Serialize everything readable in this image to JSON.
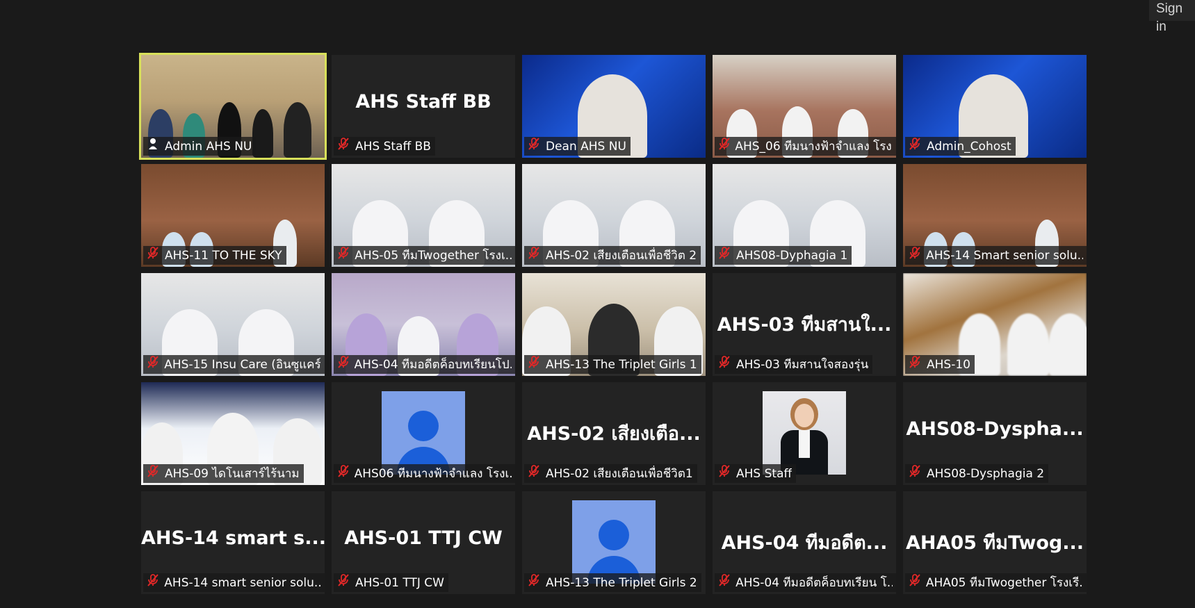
{
  "header": {
    "signin_label": "Sign in"
  },
  "colors": {
    "background": "#1a1a1a",
    "tile": "#232323",
    "active_speaker": "#d8e05a",
    "muted": "#e02828"
  },
  "participants": [
    {
      "name": "Admin AHS NU",
      "big": "",
      "kind": "video",
      "scene": "v-room",
      "active": true,
      "icon": "pin-icon"
    },
    {
      "name": "AHS Staff BB",
      "big": "AHS Staff BB",
      "kind": "name",
      "scene": "",
      "active": false,
      "icon": "mic-muted-icon"
    },
    {
      "name": "Dean AHS NU",
      "big": "",
      "kind": "video",
      "scene": "v-blue",
      "active": false,
      "icon": "mic-muted-icon"
    },
    {
      "name": "AHS_06 ทีมนางฟ้าจำแลง โรง...",
      "big": "",
      "kind": "video",
      "scene": "v-class",
      "active": false,
      "icon": "mic-muted-icon"
    },
    {
      "name": "Admin_Cohost",
      "big": "",
      "kind": "video",
      "scene": "v-blue",
      "active": false,
      "icon": "mic-muted-icon"
    },
    {
      "name": "AHS-11 TO THE SKY",
      "big": "",
      "kind": "video",
      "scene": "v-tv",
      "active": false,
      "icon": "mic-muted-icon"
    },
    {
      "name": "AHS-05 ทีมTwogether โรงเ...",
      "big": "",
      "kind": "video",
      "scene": "v-wall",
      "active": false,
      "icon": "mic-muted-icon"
    },
    {
      "name": "AHS-02 เสียงเตือนเพื่อชีวิต 2",
      "big": "",
      "kind": "video",
      "scene": "v-wall",
      "active": false,
      "icon": "mic-muted-icon"
    },
    {
      "name": "AHS08-Dyphagia 1",
      "big": "",
      "kind": "video",
      "scene": "v-wall",
      "active": false,
      "icon": "mic-muted-icon"
    },
    {
      "name": "AHS-14 Smart senior solu...",
      "big": "",
      "kind": "video",
      "scene": "v-tv",
      "active": false,
      "icon": "mic-muted-icon"
    },
    {
      "name": "AHS-15 Insu Care (อินซูแคร์)",
      "big": "",
      "kind": "video",
      "scene": "v-wall",
      "active": false,
      "icon": "mic-muted-icon"
    },
    {
      "name": "AHS-04 ทีมอดีตค็อบทเรียนโป...",
      "big": "",
      "kind": "video",
      "scene": "v-lib",
      "active": false,
      "icon": "mic-muted-icon"
    },
    {
      "name": "AHS-13 The Triplet Girls 1",
      "big": "",
      "kind": "video",
      "scene": "v-shelf",
      "active": false,
      "icon": "mic-muted-icon"
    },
    {
      "name": "AHS-03 ทีมสานใจสองรุ่น",
      "big": "AHS-03 ทีมสานใ...",
      "kind": "name",
      "scene": "",
      "active": false,
      "icon": "mic-muted-icon"
    },
    {
      "name": "AHS-10",
      "big": "",
      "kind": "video",
      "scene": "v-blur",
      "active": false,
      "icon": "mic-muted-icon"
    },
    {
      "name": "AHS-09 ไดโนเสาร์ไร้นาม",
      "big": "",
      "kind": "video",
      "scene": "v-dark",
      "active": false,
      "icon": "mic-muted-icon"
    },
    {
      "name": "AHS06 ทีมนางฟ้าจำแลง โรงเ...",
      "big": "",
      "kind": "avatar",
      "scene": "",
      "active": false,
      "icon": "mic-muted-icon"
    },
    {
      "name": "AHS-02 เสียงเตือนเพื่อชีวิต1",
      "big": "AHS-02 เสียงเตือ...",
      "kind": "name",
      "scene": "",
      "active": false,
      "icon": "mic-muted-icon"
    },
    {
      "name": "AHS Staff",
      "big": "",
      "kind": "photo",
      "scene": "",
      "active": false,
      "icon": "mic-muted-icon"
    },
    {
      "name": "AHS08-Dysphagia 2",
      "big": "AHS08-Dyspha...",
      "kind": "name",
      "scene": "",
      "active": false,
      "icon": "mic-muted-icon"
    },
    {
      "name": "AHS-14 smart senior solu...",
      "big": "AHS-14 smart s...",
      "kind": "name",
      "scene": "",
      "active": false,
      "icon": "mic-muted-icon"
    },
    {
      "name": "AHS-01 TTJ CW",
      "big": "AHS-01 TTJ CW",
      "kind": "name",
      "scene": "",
      "active": false,
      "icon": "mic-muted-icon"
    },
    {
      "name": "AHS-13 The Triplet Girls 2",
      "big": "",
      "kind": "avatar",
      "scene": "",
      "active": false,
      "icon": "mic-muted-icon"
    },
    {
      "name": "AHS-04 ทีมอดีตค็อบทเรียน โ...",
      "big": "AHS-04 ทีมอดีต...",
      "kind": "name",
      "scene": "",
      "active": false,
      "icon": "mic-muted-icon"
    },
    {
      "name": "AHA05 ทีมTwogether โรงเรี...",
      "big": "AHA05 ทีมTwog...",
      "kind": "name",
      "scene": "",
      "active": false,
      "icon": "mic-muted-icon"
    }
  ]
}
